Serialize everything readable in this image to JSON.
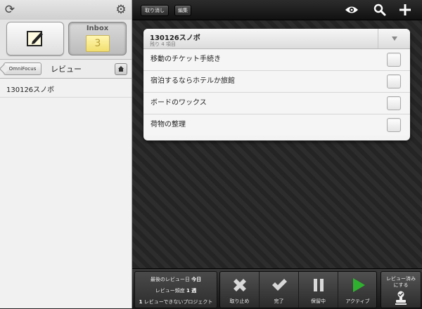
{
  "sidebar": {
    "refresh_icon": "refresh-icon",
    "gear_icon": "gear-icon",
    "inbox": {
      "label": "Inbox",
      "count": "3"
    },
    "nav": {
      "back_label": "OmniFocus",
      "title": "レビュー"
    },
    "items": [
      {
        "label": "130126スノボ"
      }
    ]
  },
  "toolbar": {
    "cancel_label": "取り消し",
    "edit_label": "編集",
    "icons": [
      "eye-icon",
      "search-icon",
      "add-icon"
    ]
  },
  "project": {
    "title": "130126スノボ",
    "subtitle": "残り 4 項目",
    "tasks": [
      {
        "label": "移動のチケット手続き",
        "checked": false
      },
      {
        "label": "宿泊するならホテルか旅館",
        "checked": false
      },
      {
        "label": "ボードのワックス",
        "checked": false
      },
      {
        "label": "荷物の整理",
        "checked": false
      }
    ]
  },
  "review": {
    "last_review_label": "最後のレビュー日",
    "last_review_value": "今日",
    "frequency_label": "レビュー頻度",
    "frequency_value": "1 週",
    "pending_count": "1",
    "pending_label": "レビューできないプロジェクト"
  },
  "status_buttons": [
    {
      "label": "取り止め",
      "icon": "x-icon"
    },
    {
      "label": "完了",
      "icon": "check-icon"
    },
    {
      "label": "保留中",
      "icon": "pause-icon"
    },
    {
      "label": "アクティブ",
      "icon": "play-icon"
    }
  ],
  "mark_reviewed": {
    "label_line1": "レビュー済み",
    "label_line2": "にする"
  },
  "colors": {
    "accent_green": "#2fb12f",
    "inbox_yellow": "#f2df6e"
  }
}
